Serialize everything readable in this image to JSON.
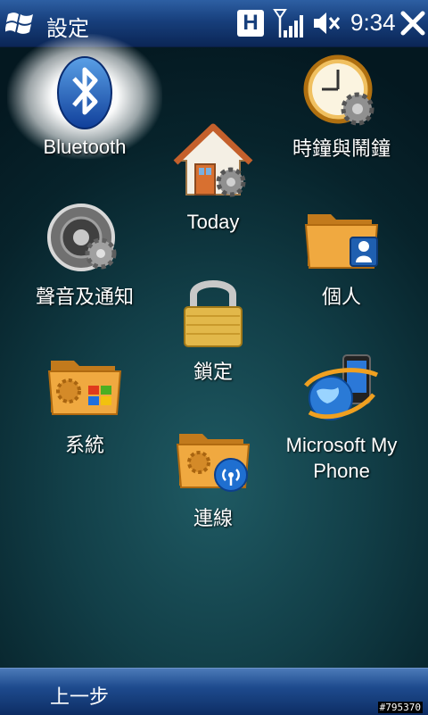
{
  "titlebar": {
    "title": "設定",
    "hsd": "H",
    "time": "9:34",
    "icons": [
      "windows-start-icon",
      "signal-icon",
      "mute-speaker-icon",
      "close-icon"
    ]
  },
  "items": [
    {
      "id": "bluetooth",
      "label": "Bluetooth",
      "icon": "bluetooth-icon",
      "selected": true
    },
    {
      "id": "clock",
      "label": "時鐘與鬧鐘",
      "icon": "clock-gear-icon"
    },
    {
      "id": "today",
      "label": "Today",
      "icon": "house-gear-icon"
    },
    {
      "id": "sound",
      "label": "聲音及通知",
      "icon": "speaker-gear-icon"
    },
    {
      "id": "personal",
      "label": "個人",
      "icon": "folder-user-icon"
    },
    {
      "id": "lock",
      "label": "鎖定",
      "icon": "padlock-icon"
    },
    {
      "id": "system",
      "label": "系統",
      "icon": "folder-windows-icon"
    },
    {
      "id": "myphone",
      "label_line1": "Microsoft My",
      "label_line2": "Phone",
      "icon": "globe-phone-icon"
    },
    {
      "id": "connections",
      "label": "連線",
      "icon": "folder-wireless-icon"
    }
  ],
  "bottombar": {
    "left_softkey": "上一步"
  },
  "watermark": "#795370",
  "colors": {
    "titlebar": "#173f7c",
    "background": "#123f48",
    "folder": "#e8a43a"
  }
}
